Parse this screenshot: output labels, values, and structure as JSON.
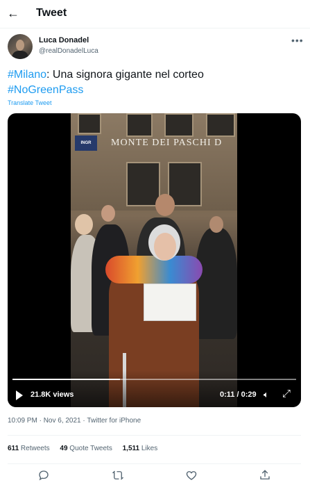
{
  "header": {
    "title": "Tweet",
    "back_icon": "arrow-left-icon"
  },
  "author": {
    "name": "Luca Donadel",
    "handle": "@realDonadelLuca"
  },
  "tweet": {
    "hashtag1": "#Milano",
    "text1": ": Una signora gigante nel corteo",
    "hashtag2": "#NoGreenPass",
    "translate_label": "Translate Tweet"
  },
  "video": {
    "sign_text": "MONTE DEI PASCHI D",
    "sign_blue_text": "INGR",
    "views": "21.8K views",
    "time": "0:11 / 0:29",
    "progress": 0.38
  },
  "meta": {
    "timestamp": "10:09 PM · Nov 6, 2021 · Twitter for iPhone"
  },
  "stats": {
    "retweets_count": "611",
    "retweets_label": "Retweets",
    "quotes_count": "49",
    "quotes_label": "Quote Tweets",
    "likes_count": "1,511",
    "likes_label": "Likes"
  },
  "actions": [
    "reply-icon",
    "retweet-icon",
    "like-icon",
    "share-icon"
  ],
  "colors": {
    "accent": "#1d9bf0",
    "muted": "#536471"
  }
}
